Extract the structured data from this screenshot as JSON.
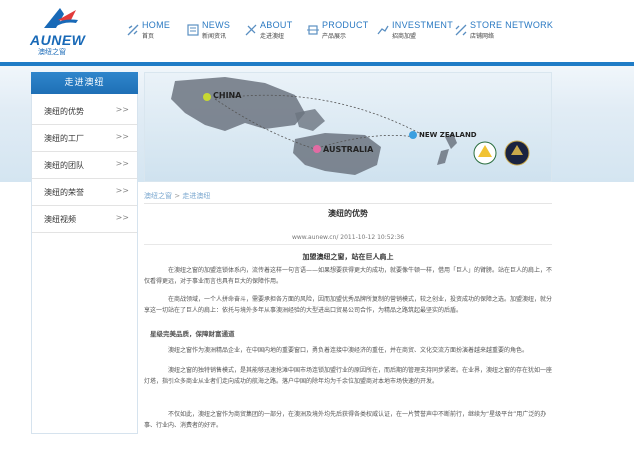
{
  "brand": {
    "name": "AUNEW",
    "sub": "澳纽之窗"
  },
  "nav": [
    {
      "en": "HOME",
      "cn": "首页"
    },
    {
      "en": "NEWS",
      "cn": "新闻资讯"
    },
    {
      "en": "ABOUT",
      "cn": "走进澳纽"
    },
    {
      "en": "PRODUCT",
      "cn": "产品展示"
    },
    {
      "en": "INVESTMENT",
      "cn": "招商加盟"
    },
    {
      "en": "STORE NETWORK",
      "cn": "店铺网络"
    }
  ],
  "sidebar": {
    "title": "走进澳纽",
    "items": [
      {
        "label": "澳纽的优势",
        "arrow": ">>"
      },
      {
        "label": "澳纽的工厂",
        "arrow": ">>"
      },
      {
        "label": "澳纽的团队",
        "arrow": ">>"
      },
      {
        "label": "澳纽的荣誉",
        "arrow": ">>"
      },
      {
        "label": "澳纽视频",
        "arrow": ">>"
      }
    ]
  },
  "banner": {
    "china": "CHINA",
    "australia": "AUSTRALIA",
    "nz": "NEW ZEALAND"
  },
  "breadcrumb": {
    "home": "澳纽之窗",
    "sep": ">",
    "current": "走进澳纽"
  },
  "article": {
    "title": "澳纽的优势",
    "meta": "www.aunew.cn/ 2011-10-12 10:52:36",
    "subtitle": "加盟澳纽之窗，站在巨人肩上",
    "p1": "在澳纽之窗的加盟连锁体系内，流传着这样一句言语——如果想要获得更大的成功，就要像牛顿一样，借用「巨人」的臂膀。站在巨人的肩上，不仅看得更远，对于事业而言也具有巨大的保障作用。",
    "p2": "在商战领域，一个人拼命奋斗，需要承担各方面的风险，因而加盟优秀品牌所复制的营销模式，较之创业，投资成功的保障之选。加盟澳纽，就分享这一切站在了巨人的肩上：依托与境外多年从事澳洲经验的大型进出口贸易公司合作，为精品之路筑起最坚实的后盾。",
    "h3": "星级完美品质，保障财富通道",
    "p3": "澳纽之窗作为澳洲精品企业，在中国内地的重要窗口，勇负着连接中澳经济的重任，并在商贸、文化交流方面扮演着越来越重要的角色。",
    "p4": "澳纽之窗的独特销售模式，是其能够迅速抢滩中国市场连锁加盟行业的原因所在，而后期的管理支持同步紧密。在业界，澳纽之窗的存在犹如一座灯塔，指引众多商业从业者们走向成功的航海之路。落户中国的除年均为千余位加盟商对本地市场快速的开发。",
    "p5": "不仅如此，澳纽之窗作为商贸集团的一部分，在澳洲及境外均先后获得各类权威认证，在一片赞誉声中不断前行，继续为“星级平台”用广泛的办事、行业内、消费者的好评。"
  },
  "colors": {
    "accent": "#1f7cc6",
    "link": "#2a79c2"
  }
}
